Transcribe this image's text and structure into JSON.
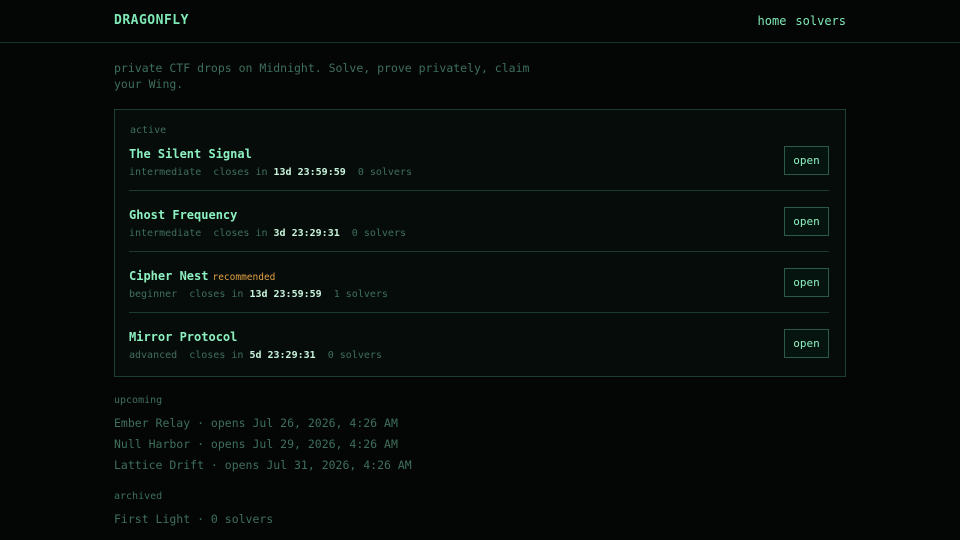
{
  "header": {
    "brand": "DRAGONFLY",
    "nav": [
      "home",
      "solvers"
    ]
  },
  "tagline": "private CTF drops on Midnight. Solve, prove privately, claim your Wing.",
  "active": {
    "label": "active",
    "challenges": [
      {
        "title": "The Silent Signal",
        "badge": "",
        "difficulty": "intermediate",
        "closes_prefix": "closes in",
        "timer": "13d 23:59:59",
        "solvers": "0 solvers",
        "button": "open"
      },
      {
        "title": "Ghost Frequency",
        "badge": "",
        "difficulty": "intermediate",
        "closes_prefix": "closes in",
        "timer": "3d 23:29:31",
        "solvers": "0 solvers",
        "button": "open"
      },
      {
        "title": "Cipher Nest",
        "badge": "recommended",
        "difficulty": "beginner",
        "closes_prefix": "closes in",
        "timer": "13d 23:59:59",
        "solvers": "1 solvers",
        "button": "open"
      },
      {
        "title": "Mirror Protocol",
        "badge": "",
        "difficulty": "advanced",
        "closes_prefix": "closes in",
        "timer": "5d 23:29:31",
        "solvers": "0 solvers",
        "button": "open"
      }
    ]
  },
  "upcoming": {
    "label": "upcoming",
    "items": [
      "Ember Relay · opens Jul 26, 2026, 4:26 AM",
      "Null Harbor · opens Jul 29, 2026, 4:26 AM",
      "Lattice Drift · opens Jul 31, 2026, 4:26 AM"
    ]
  },
  "archived": {
    "label": "archived",
    "items": [
      "First Light · 0 solvers"
    ]
  },
  "colors": {
    "background": "#030605",
    "accent": "#7fe8b6",
    "muted": "#3f6f5c",
    "timer": "#c8f5dc",
    "badge": "#e0a044"
  }
}
